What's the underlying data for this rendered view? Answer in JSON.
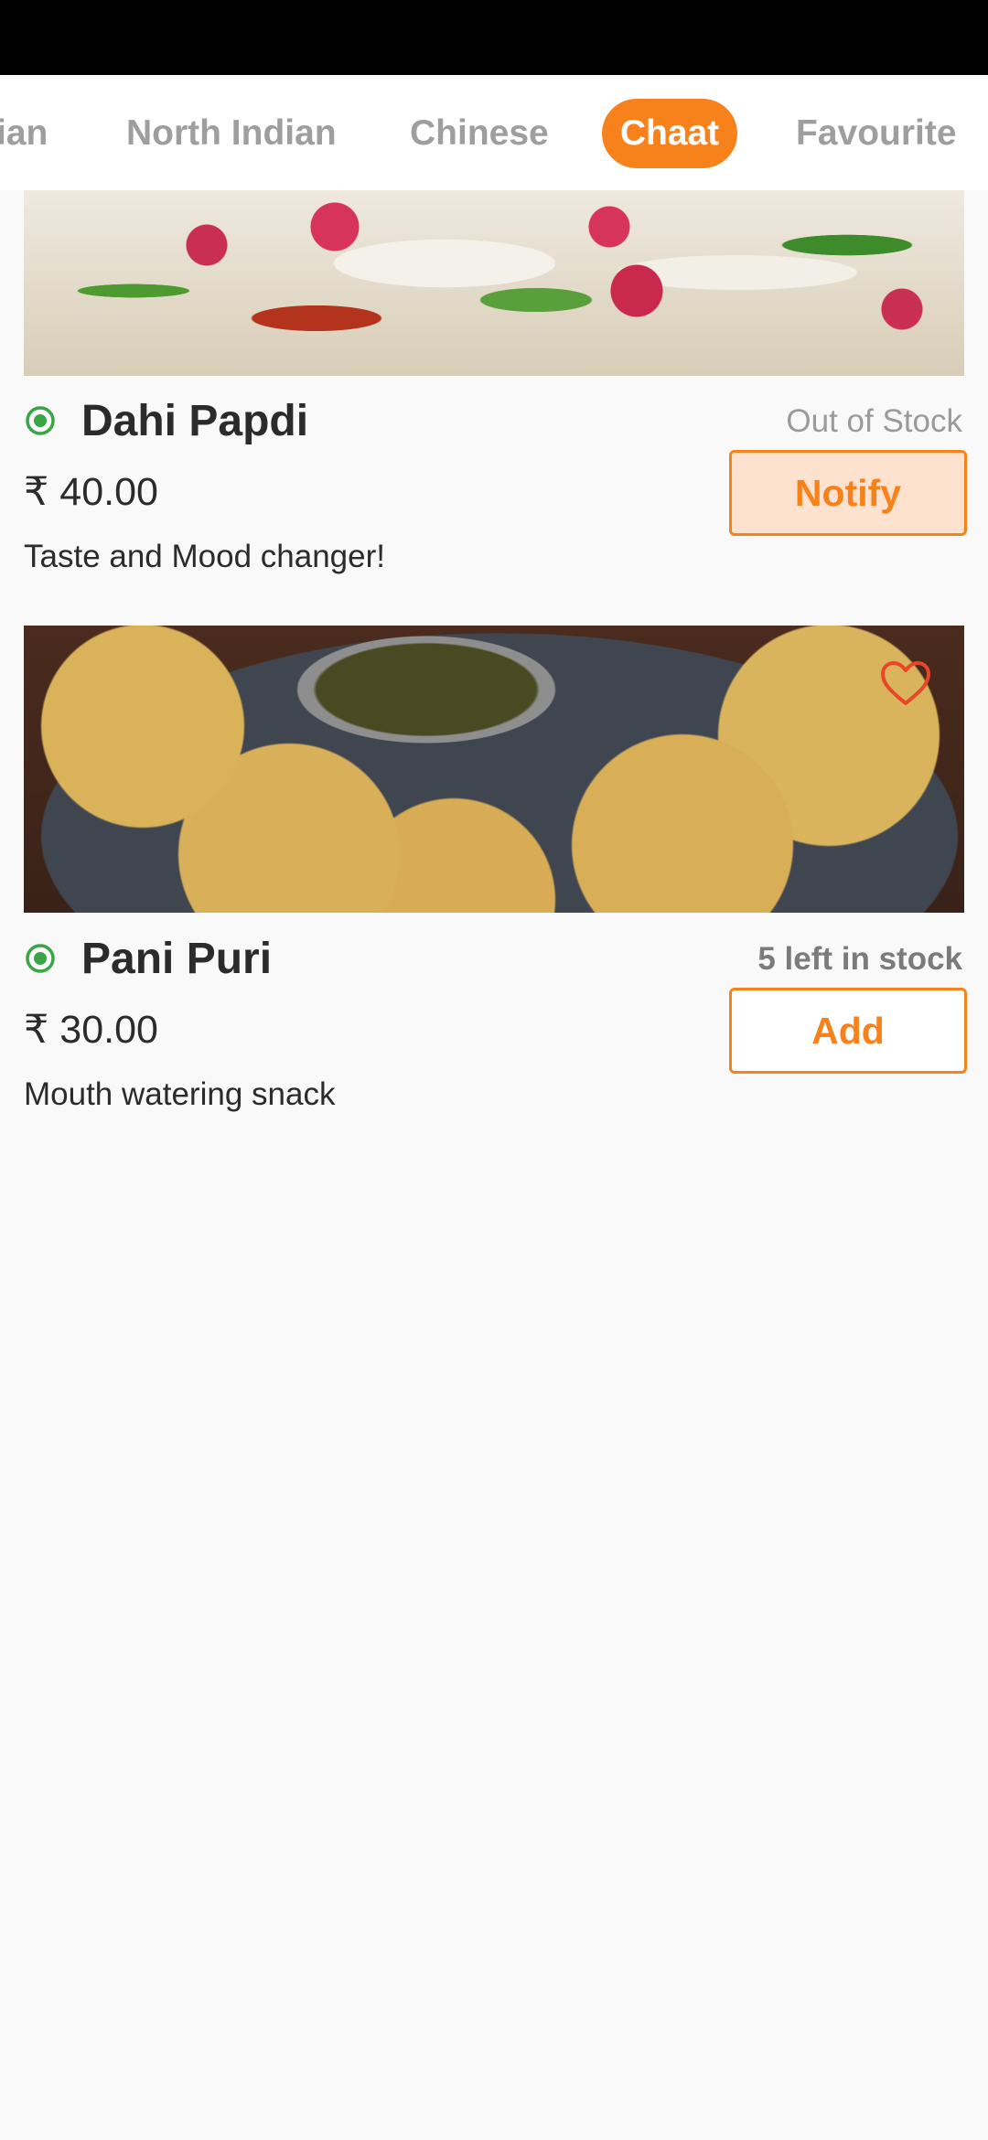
{
  "tabs": [
    {
      "label": "ian"
    },
    {
      "label": "North Indian"
    },
    {
      "label": "Chinese"
    },
    {
      "label": "Chaat",
      "active": true
    },
    {
      "label": "Favourite"
    }
  ],
  "items": [
    {
      "name": "Dahi Papdi",
      "price": "₹ 40.00",
      "description": "Taste and Mood changer!",
      "stock": "Out of Stock",
      "action": "Notify",
      "image": "dahi-papdi-photo"
    },
    {
      "name": "Pani Puri",
      "price": "₹ 30.00",
      "description": "Mouth watering snack",
      "stock": "5 left in stock",
      "action": "Add",
      "image": "pani-puri-photo",
      "favourite_icon": "heart-icon"
    }
  ],
  "colors": {
    "accent": "#f7821b",
    "veg": "#3aa545",
    "favourite": "#e8452b",
    "tab_inactive": "#9e9e9e"
  }
}
